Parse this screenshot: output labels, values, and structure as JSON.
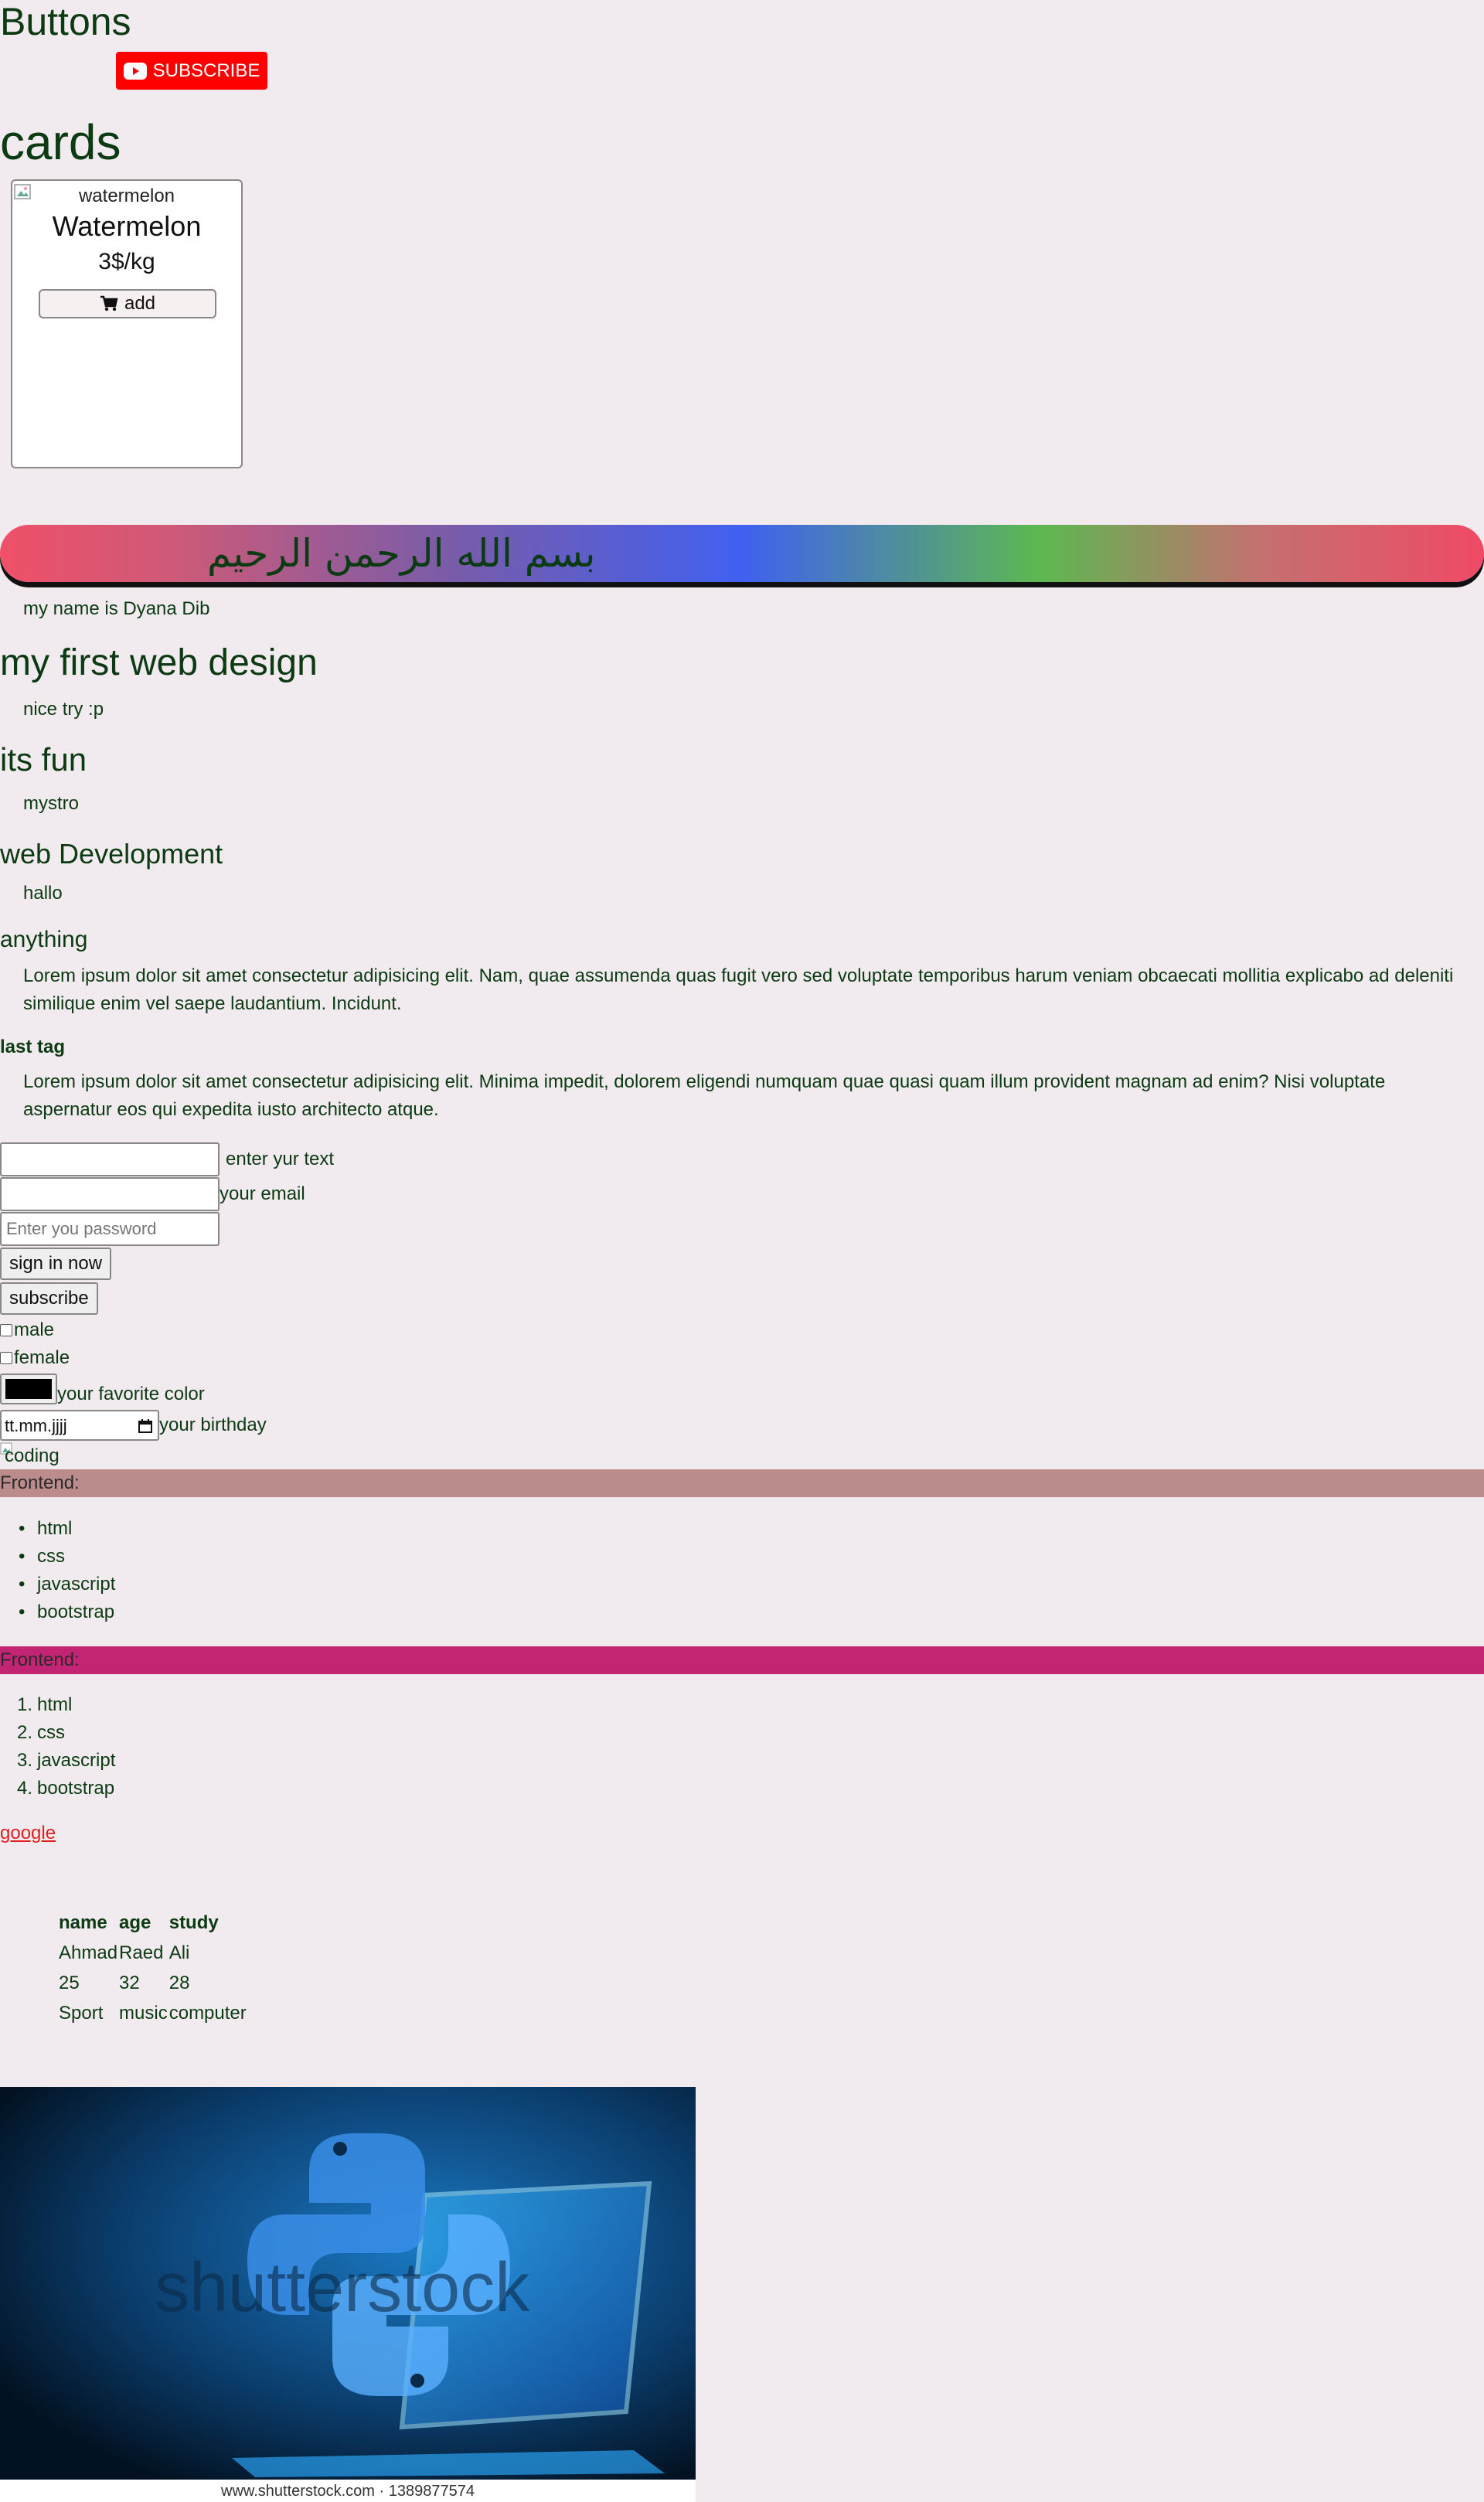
{
  "sections": {
    "buttons_title": "Buttons",
    "cards_title": "cards"
  },
  "subscribe_button": {
    "label": "SUBSCRIBE",
    "icon": "youtube-icon",
    "color": "#ff0000"
  },
  "card": {
    "image_alt": "watermelon",
    "title": "Watermelon",
    "price": "3$/kg",
    "add_label": "add",
    "add_icon": "cart-icon"
  },
  "banner": {
    "text": "بسم الله الرحمن الرحيم"
  },
  "content": {
    "name_text": "my name is Dyana Dib",
    "h1": "my first web design",
    "p1": "nice try :p",
    "h2": "its fun",
    "p2": "mystro",
    "h3": "web Development",
    "p3": "hallo",
    "h4": "anything",
    "lorem1_line1": "Lorem ipsum dolor sit amet consectetur adipisicing elit. Nam, quae assumenda quas fugit vero sed voluptate temporibus harum veniam obcaecati mollitia explicabo ad deleniti",
    "lorem1_line2": "similique enim vel saepe laudantium. Incidunt.",
    "h5": "last tag",
    "lorem2_line1": "Lorem ipsum dolor sit amet consectetur adipisicing elit. Minima impedit, dolorem eligendi numquam quae quasi quam illum provident magnam ad enim? Nisi voluptate",
    "lorem2_line2": "aspernatur eos qui expedita iusto architecto atque."
  },
  "form": {
    "text_label": "enter yur text",
    "email_label": "your email",
    "password_placeholder": "Enter you password",
    "signin_label": "sign in now",
    "subscribe_label": "subscribe",
    "male_label": "male",
    "female_label": "female",
    "color_label": "your favorite color",
    "color_value": "#000000",
    "date_value": "tt.mm.jjjj",
    "birthday_label": "your birthday",
    "coding_alt": "coding"
  },
  "lists": {
    "ul_title": "Frontend:",
    "ul_items": [
      "html",
      "css",
      "javascript",
      "bootstrap"
    ],
    "ol_title": "Frontend:",
    "ol_items": [
      "html",
      "css",
      "javascript",
      "bootstrap"
    ],
    "ul_bar_color": "#bc8c8c",
    "ol_bar_color": "#c42474"
  },
  "link": {
    "label": "google"
  },
  "table": {
    "headers": [
      "name",
      "age",
      "study"
    ],
    "rows": [
      [
        "Ahmad",
        "Raed",
        "Ali"
      ],
      [
        "25",
        "32",
        "28"
      ],
      [
        "Sport",
        "music",
        "computer"
      ]
    ]
  },
  "python_image": {
    "watermark": "shutterstock",
    "caption": "www.shutterstock.com · 1389877574"
  }
}
